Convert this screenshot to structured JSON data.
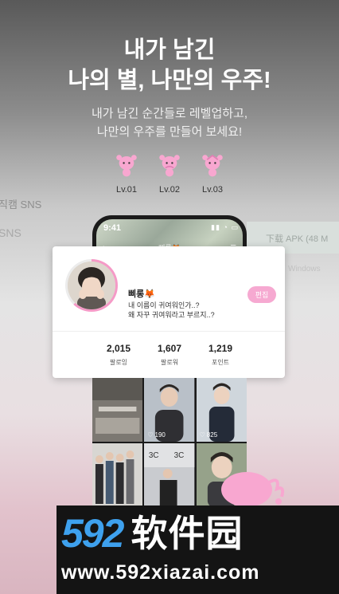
{
  "headline": {
    "line1": "내가 남긴",
    "line2": "나의 별, 나만의 우주!"
  },
  "subtitle": {
    "line1": "내가 남긴 순간들로 레벨업하고,",
    "line2": "나만의 우주를 만들어 보세요!"
  },
  "levels": [
    {
      "label": "Lv.01"
    },
    {
      "label": "Lv.02"
    },
    {
      "label": "Lv.03"
    }
  ],
  "background": {
    "sns_text": "직캠 SNS",
    "sns2": "SNS",
    "download": "下载 APK (48 M",
    "win": "Windows"
  },
  "phone": {
    "time": "9:41",
    "status": "▮▮ ◔ ▭",
    "username": "삐롱🦊"
  },
  "profile": {
    "name": "삐롱🦊",
    "bio_line1": "내 이름이 귀여워인가..?",
    "bio_line2": "왜 자꾸 귀여워라고 부르지..?",
    "edit_label": "편집",
    "stats": [
      {
        "value": "2,015",
        "label": "팔로잉"
      },
      {
        "value": "1,607",
        "label": "팔로워"
      },
      {
        "value": "1,219",
        "label": "포인트"
      }
    ]
  },
  "posts": [
    {
      "likes": ""
    },
    {
      "likes": "190"
    },
    {
      "likes": "825"
    },
    {
      "likes": ""
    },
    {
      "likes": ""
    },
    {
      "likes": ""
    }
  ],
  "banner": {
    "logo_digits": "592",
    "logo_text": "软件园",
    "url": "www.592xiazai.com"
  },
  "colors": {
    "accent_pink": "#f6a9d1",
    "logo_blue": "#3ea1ee",
    "ring_pink": "#f59ac7"
  },
  "icons": {
    "level": "pink-creature-icon",
    "like": "heart-icon",
    "back": "chevron-left-icon",
    "menu": "hamburger-icon"
  }
}
